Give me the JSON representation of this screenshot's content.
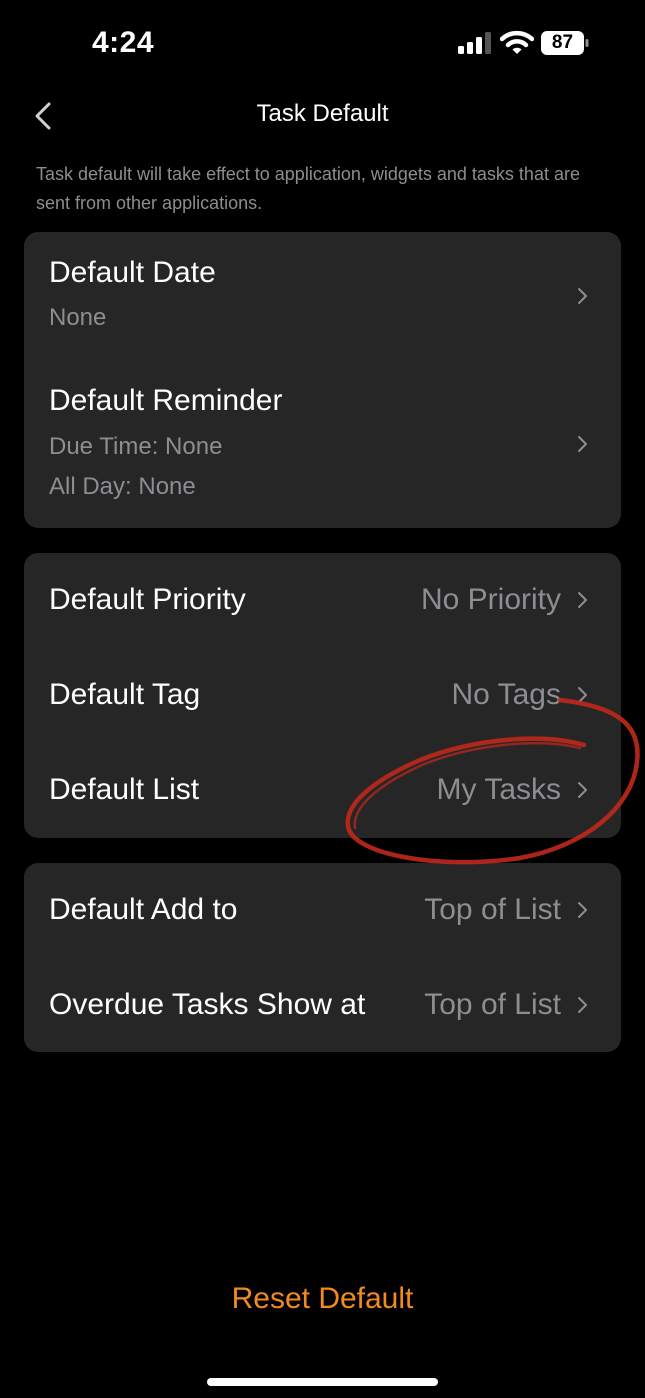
{
  "status": {
    "time": "4:24",
    "battery": "87"
  },
  "header": {
    "title": "Task Default"
  },
  "description": "Task default will take effect to application, widgets and tasks that are sent from other applications.",
  "card1": {
    "default_date": {
      "label": "Default Date",
      "value": "None"
    },
    "default_reminder": {
      "label": "Default Reminder",
      "due_time": "Due Time: None",
      "all_day": "All Day: None"
    }
  },
  "card2": {
    "priority": {
      "label": "Default Priority",
      "value": "No Priority"
    },
    "tag": {
      "label": "Default Tag",
      "value": "No Tags"
    },
    "list": {
      "label": "Default List",
      "value": "My Tasks"
    }
  },
  "card3": {
    "add_to": {
      "label": "Default Add to",
      "value": "Top of List"
    },
    "overdue": {
      "label": "Overdue Tasks Show at",
      "value": "Top of List"
    }
  },
  "footer": {
    "reset_label": "Reset Default"
  },
  "colors": {
    "accent": "#f28a1e",
    "annotation": "#c0281c",
    "card": "#262627",
    "secondary_text": "#8d8d92"
  },
  "icons": [
    "signal-icon",
    "wifi-icon",
    "battery-icon",
    "back-chevron-icon",
    "chevron-right-icon"
  ]
}
